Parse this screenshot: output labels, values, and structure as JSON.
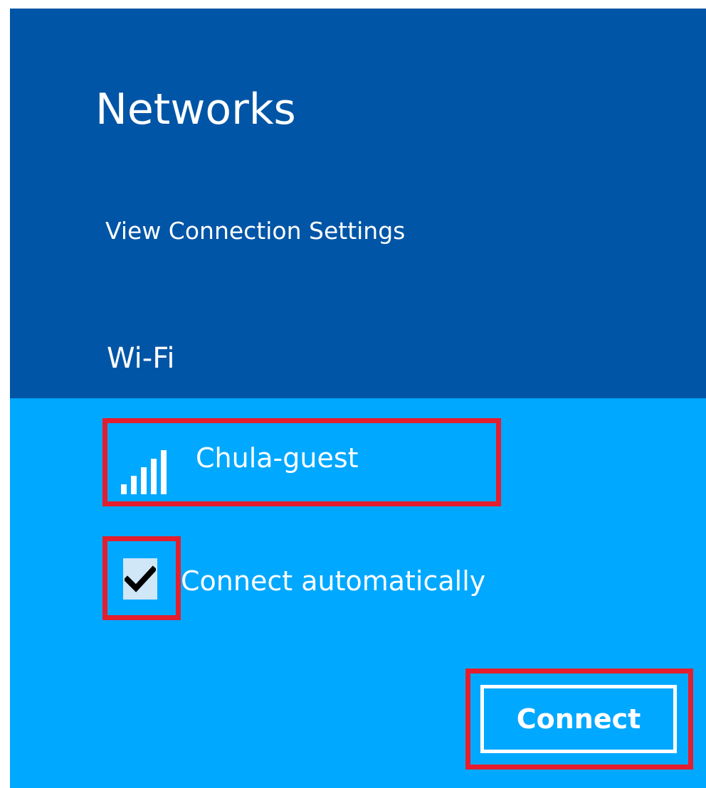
{
  "panel": {
    "title": "Networks",
    "view_settings_link": "View Connection Settings",
    "section_title": "Wi-Fi"
  },
  "network": {
    "name": "Chula-guest",
    "signal_icon": "wifi-signal-bars-icon",
    "signal_level": 5,
    "signal_max": 5
  },
  "options": {
    "connect_automatically_label": "Connect automatically",
    "connect_automatically_checked": true,
    "checkbox_icon": "checkmark-icon"
  },
  "actions": {
    "connect_label": "Connect"
  },
  "colors": {
    "header_background": "#0055a6",
    "list_background": "#00a8ff",
    "highlight_border": "#e41e2e",
    "text": "#ffffff",
    "checkbox_fill": "#cfe7f7"
  }
}
